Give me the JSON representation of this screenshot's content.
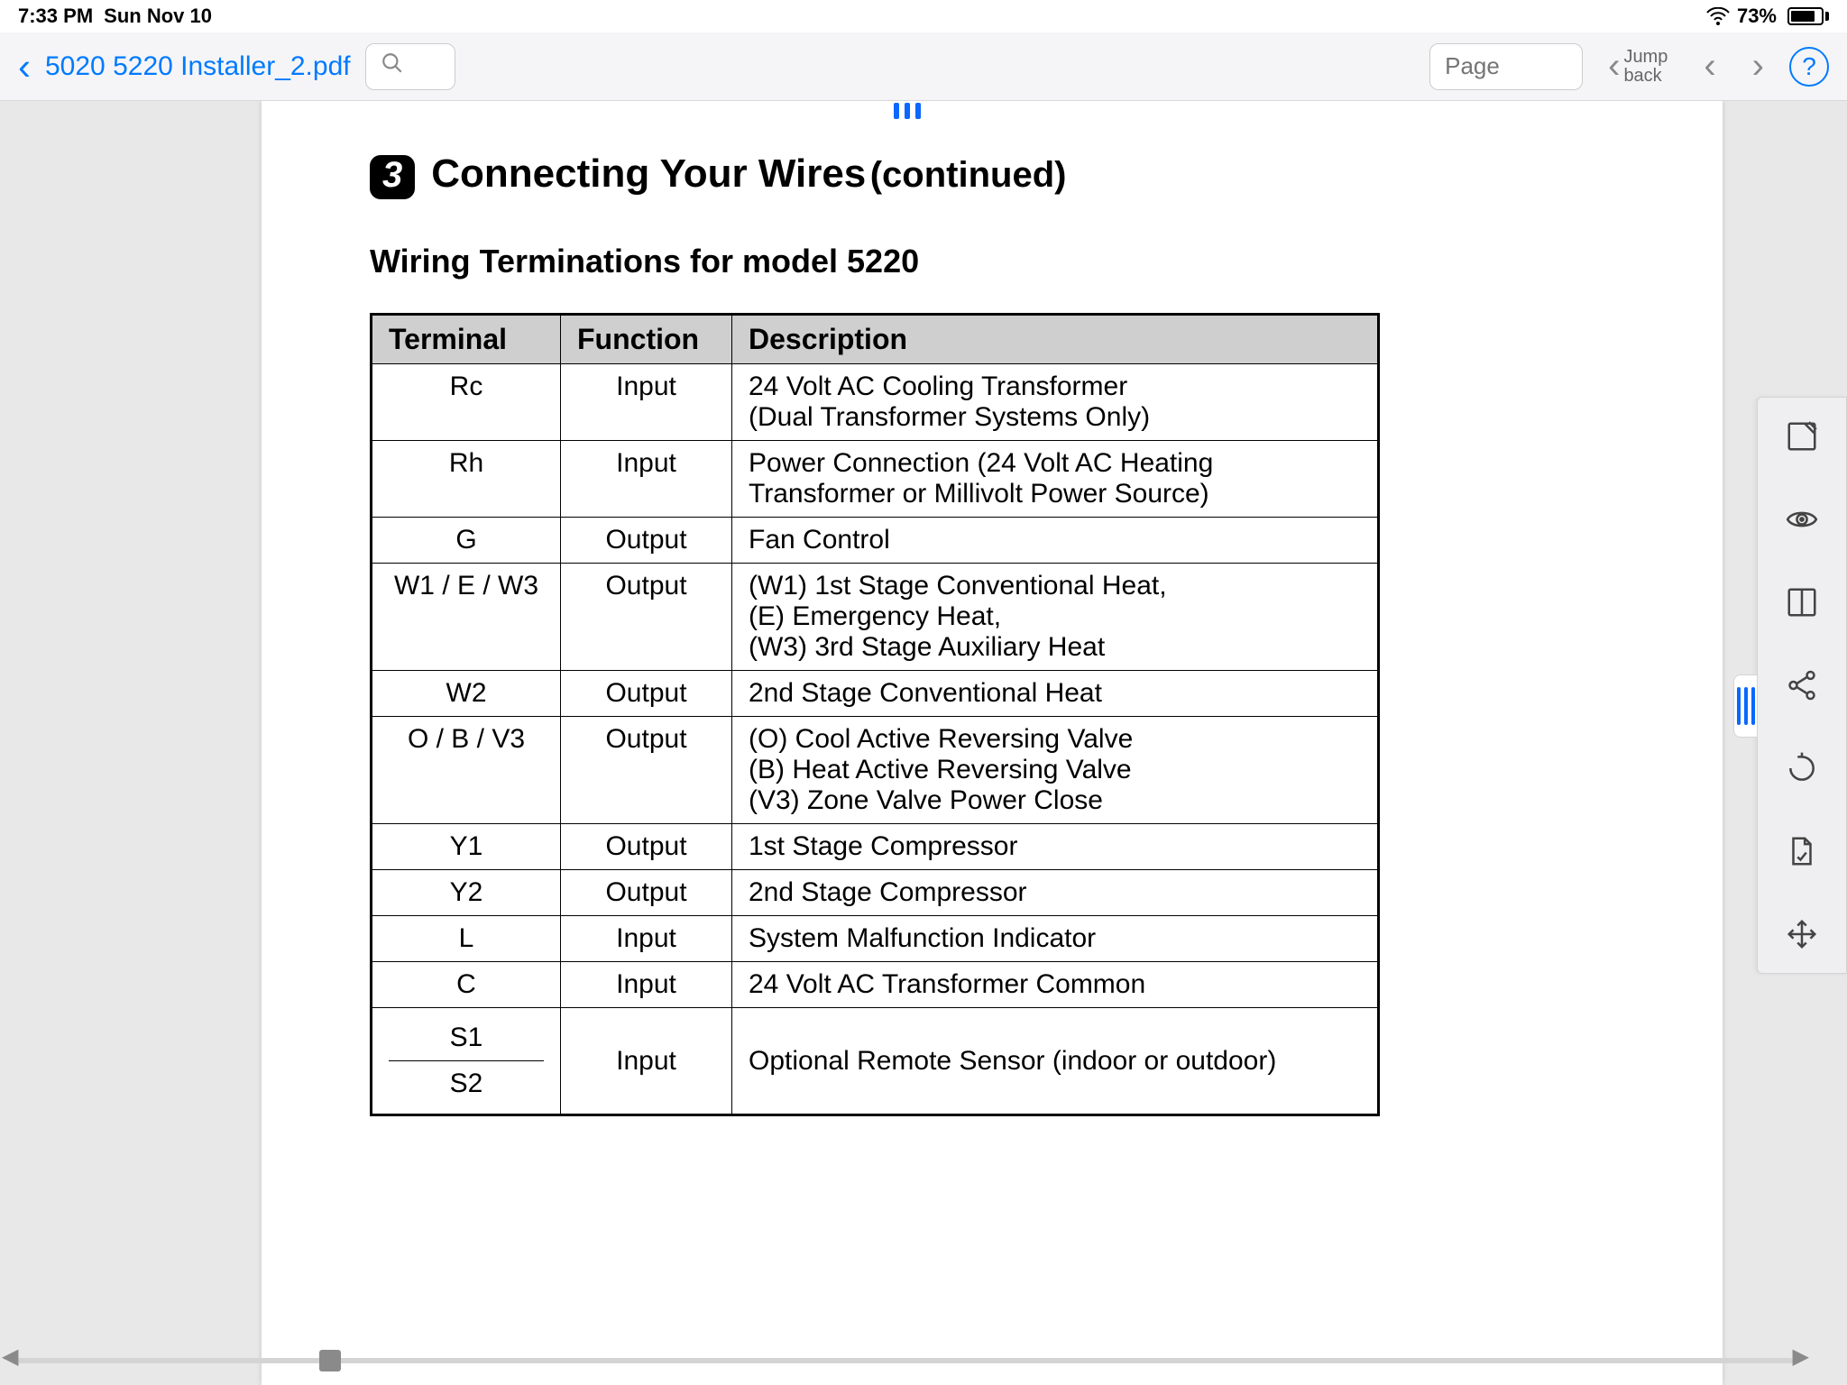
{
  "status": {
    "time": "7:33 PM",
    "date": "Sun Nov 10",
    "battery_pct": "73%"
  },
  "toolbar": {
    "doc_title": "5020 5220 Installer_2.pdf",
    "page_placeholder": "Page",
    "jump_back": "Jump\nback"
  },
  "section": {
    "number": "3",
    "title": "Connecting Your Wires",
    "cont": "(continued)",
    "subhead": "Wiring Terminations for model 5220"
  },
  "table": {
    "headers": {
      "c0": "Terminal",
      "c1": "Function",
      "c2": "Description"
    },
    "rows": [
      {
        "terminal": "Rc",
        "function": "Input",
        "desc": "24 Volt AC Cooling Transformer\n(Dual Transformer Systems Only)"
      },
      {
        "terminal": "Rh",
        "function": "Input",
        "desc": "Power Connection (24 Volt AC Heating Transformer or Millivolt Power Source)"
      },
      {
        "terminal": "G",
        "function": "Output",
        "desc": "Fan Control"
      },
      {
        "terminal": "W1 / E / W3",
        "function": "Output",
        "desc": "(W1) 1st Stage Conventional Heat,\n(E) Emergency Heat,\n(W3) 3rd Stage Auxiliary Heat"
      },
      {
        "terminal": "W2",
        "function": "Output",
        "desc": "2nd Stage Conventional Heat"
      },
      {
        "terminal": "O / B / V3",
        "function": "Output",
        "desc": "(O) Cool Active Reversing Valve\n(B) Heat Active Reversing Valve\n(V3) Zone Valve Power Close"
      },
      {
        "terminal": "Y1",
        "function": "Output",
        "desc": "1st Stage Compressor"
      },
      {
        "terminal": "Y2",
        "function": "Output",
        "desc": "2nd Stage Compressor"
      },
      {
        "terminal": "L",
        "function": "Input",
        "desc": "System Malfunction Indicator"
      },
      {
        "terminal": "C",
        "function": "Input",
        "desc": "24 Volt AC Transformer Common"
      }
    ],
    "split_row": {
      "terminal_top": "S1",
      "terminal_bot": "S2",
      "function": "Input",
      "desc": "Optional Remote Sensor (indoor or outdoor)"
    }
  }
}
